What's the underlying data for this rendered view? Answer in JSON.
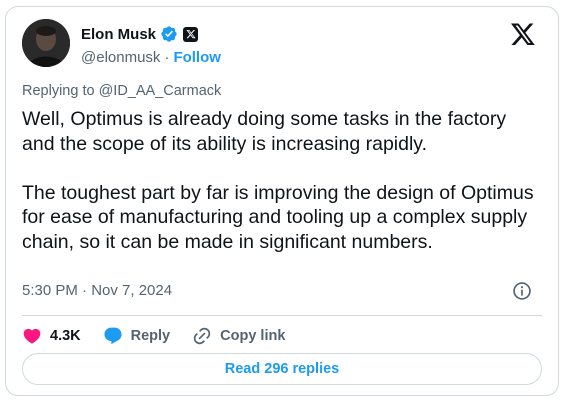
{
  "author": {
    "name": "Elon Musk",
    "handle": "@elonmusk",
    "follow_label": "Follow",
    "separator": "·"
  },
  "post": {
    "replying_prefix": "Replying to ",
    "replying_to": "@ID_AA_Carmack",
    "text": "Well, Optimus is already doing some tasks in the factory and the scope of its ability is increasing rapidly.\n\nThe toughest part by far is improving the design of Optimus for ease of manufacturing and tooling up a complex supply chain, so it can be made in significant numbers.",
    "timestamp": "5:30 PM · Nov 7, 2024"
  },
  "actions": {
    "likes": "4.3K",
    "reply_label": "Reply",
    "copy_link_label": "Copy link",
    "read_replies_label": "Read 296 replies"
  },
  "colors": {
    "accent": "#1d9bf0",
    "like": "#f91880",
    "text": "#0f1419",
    "muted": "#536471",
    "border": "#cfd9de"
  },
  "icons": [
    "avatar-photo",
    "verified-badge-icon",
    "x-affiliate-badge-icon",
    "x-logo-icon",
    "info-icon",
    "heart-icon",
    "reply-bubble-icon",
    "link-icon"
  ]
}
